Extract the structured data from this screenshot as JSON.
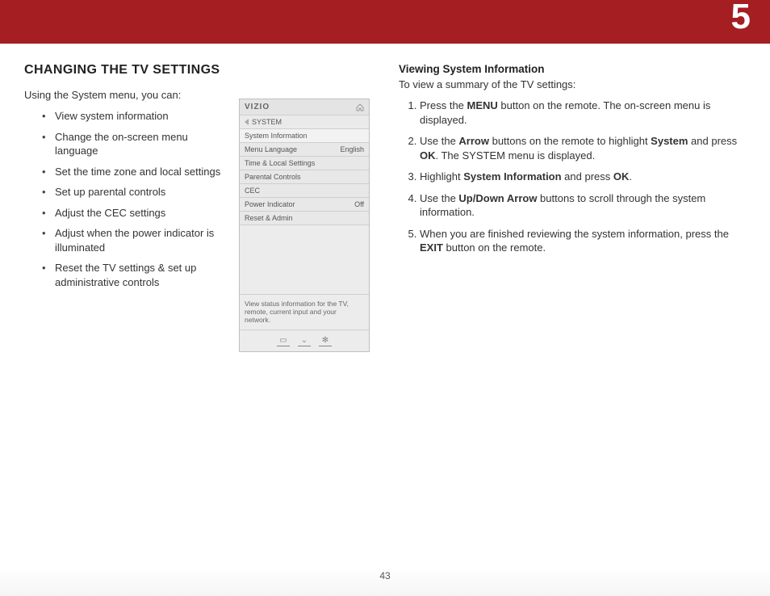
{
  "chapter_number": "5",
  "page_number": "43",
  "section_title": "CHANGING THE TV SETTINGS",
  "intro_text": "Using the System menu, you can:",
  "bullets": [
    "View system information",
    "Change the on-screen menu language",
    "Set the time zone and local settings",
    "Set up parental controls",
    "Adjust the CEC settings",
    "Adjust when the power indicator is illuminated",
    "Reset the TV settings & set up administrative controls"
  ],
  "tv_menu": {
    "brand": "VIZIO",
    "breadcrumb": "SYSTEM",
    "items": [
      {
        "label": "System Information",
        "value": ""
      },
      {
        "label": "Menu Language",
        "value": "English"
      },
      {
        "label": "Time & Local Settings",
        "value": ""
      },
      {
        "label": "Parental Controls",
        "value": ""
      },
      {
        "label": "CEC",
        "value": ""
      },
      {
        "label": "Power Indicator",
        "value": "Off"
      },
      {
        "label": "Reset & Admin",
        "value": ""
      }
    ],
    "help_text": "View status information for the TV, remote, current input and your network."
  },
  "right": {
    "subheading": "Viewing System Information",
    "intro": "To view a summary of the TV settings:",
    "steps": [
      "Press the <b>MENU</b> button on the remote. The on-screen menu is displayed.",
      "Use the <b>Arrow</b> buttons on the remote to highlight <b>System</b> and press <b>OK</b>. The SYSTEM menu is displayed.",
      "Highlight <b>System Information</b> and press <b>OK</b>.",
      "Use the <b>Up/Down Arrow</b> buttons to scroll through the system information.",
      "When you are finished reviewing the system information, press the <b>EXIT</b> button on the remote."
    ]
  }
}
